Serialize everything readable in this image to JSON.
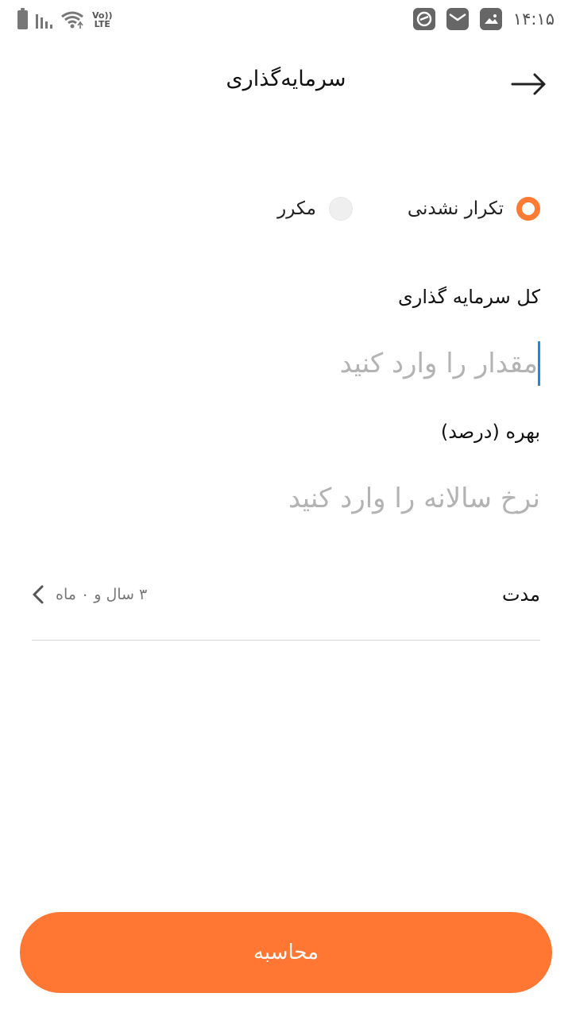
{
  "status_bar": {
    "time": "۱۴:۱۵",
    "network_label_top": "Vo))",
    "network_label_bottom": "LTE",
    "icons": [
      "battery-icon",
      "signal-icon",
      "wifi-icon",
      "app-notification-icon",
      "mail-icon",
      "image-icon"
    ]
  },
  "header": {
    "title": "سرمایه‌گذاری",
    "back_icon": "arrow-right-icon"
  },
  "radio_group": {
    "options": [
      {
        "label": "تکرار نشدنی",
        "selected": true
      },
      {
        "label": "مکرر",
        "selected": false
      }
    ]
  },
  "form": {
    "amount_label": "کل سرمایه گذاری",
    "amount_placeholder": "مقدار را وارد کنید",
    "amount_value": "",
    "rate_label": "بهره (درصد)",
    "rate_placeholder": "نرخ سالانه را وارد کنید",
    "rate_value": "",
    "duration_label": "مدت",
    "duration_value": "۳ سال و ۰ ماه"
  },
  "actions": {
    "calculate_label": "محاسبه"
  },
  "colors": {
    "accent": "#ff7733",
    "cursor": "#1e88e5",
    "placeholder": "#b3b3b3"
  }
}
